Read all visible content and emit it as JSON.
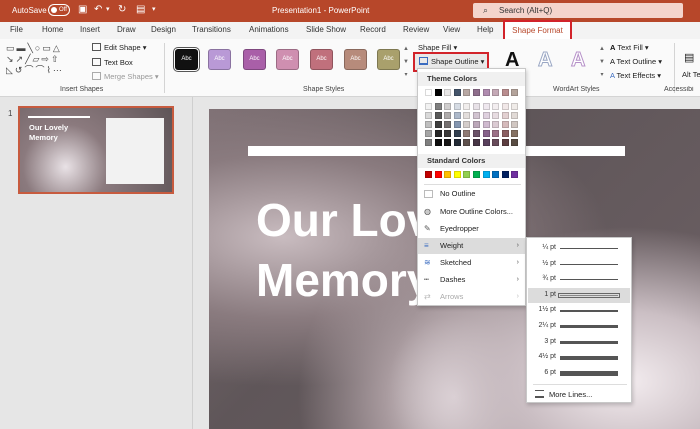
{
  "titlebar": {
    "autosave_label": "AutoSave",
    "autosave_state": "Off",
    "title": "Presentation1 - PowerPoint",
    "search_placeholder": "Search (Alt+Q)"
  },
  "tabs": [
    "File",
    "Home",
    "Insert",
    "Draw",
    "Design",
    "Transitions",
    "Animations",
    "Slide Show",
    "Record",
    "Review",
    "View",
    "Help"
  ],
  "active_tab": "Shape Format",
  "ribbon": {
    "insert_shapes": {
      "label": "Insert Shapes",
      "edit_shape": "Edit Shape",
      "text_box": "Text Box",
      "merge_shapes": "Merge Shapes"
    },
    "shape_styles": {
      "label": "Shape Styles",
      "swatch_text": "Abc",
      "swatch_colors": [
        "#111111",
        "#b999d6",
        "#a95fa8",
        "#cf8fb0",
        "#c0707c",
        "#b78b7b",
        "#a9a06c"
      ],
      "shape_fill": "Shape Fill",
      "shape_outline": "Shape Outline"
    },
    "wordart": {
      "label": "WordArt Styles",
      "letter": "A",
      "text_fill": "Text Fill",
      "text_outline": "Text Outline",
      "text_effects": "Text Effects"
    },
    "accessibility_label": "Accessibi",
    "alt_text_label": "Alt Te"
  },
  "thumbnail": {
    "number": "1",
    "title": "Our Lovely Memory"
  },
  "slide": {
    "title": "Our Lovely\nMemory"
  },
  "outline_menu": {
    "theme_colors_label": "Theme Colors",
    "standard_colors_label": "Standard Colors",
    "theme_top_row": [
      "#ffffff",
      "#000000",
      "#e7e6e6",
      "#44546a",
      "#b8a8a4",
      "#8e6e8c",
      "#b08cb0",
      "#c4a9b6",
      "#b98d8f",
      "#b3a39a"
    ],
    "theme_shades": [
      [
        "#f2f2f2",
        "#7f7f7f",
        "#d0cece",
        "#d6dce4",
        "#f1eeed",
        "#e8e2e8",
        "#efe8ef",
        "#f3eef0",
        "#f1e8e8",
        "#f0ece9"
      ],
      [
        "#d9d9d9",
        "#595959",
        "#aeabab",
        "#adb9ca",
        "#e3dedc",
        "#d2c4d1",
        "#dfd1df",
        "#e7dce1",
        "#e3d1d2",
        "#e1dad6"
      ],
      [
        "#bfbfbf",
        "#3f3f3f",
        "#757070",
        "#8496b0",
        "#d4cdcb",
        "#bba7b9",
        "#cfbacf",
        "#dbcbd3",
        "#d5babb",
        "#d1c7c2"
      ],
      [
        "#a5a5a5",
        "#262626",
        "#3a3838",
        "#323f4f",
        "#8f7a74",
        "#6a5168",
        "#86618a",
        "#9c7187",
        "#8a5e61",
        "#867263"
      ],
      [
        "#7f7f7f",
        "#0d0d0d",
        "#171616",
        "#222a35",
        "#5f514d",
        "#473645",
        "#59405c",
        "#684b5a",
        "#5c3e40",
        "#594c42"
      ]
    ],
    "standard_colors": [
      "#c00000",
      "#ff0000",
      "#ffc000",
      "#ffff00",
      "#92d050",
      "#00b050",
      "#00b0f0",
      "#0070c0",
      "#002060",
      "#7030a0"
    ],
    "no_outline": "No Outline",
    "more_outline_colors": "More Outline Colors...",
    "eyedropper": "Eyedropper",
    "weight": "Weight",
    "sketched": "Sketched",
    "dashes": "Dashes",
    "arrows": "Arrows"
  },
  "weight_menu": {
    "items": [
      "¼ pt",
      "½ pt",
      "¾ pt",
      "1 pt",
      "1½ pt",
      "2¼ pt",
      "3 pt",
      "4½ pt",
      "6 pt"
    ],
    "selected": "1 pt",
    "more_lines": "More Lines..."
  }
}
